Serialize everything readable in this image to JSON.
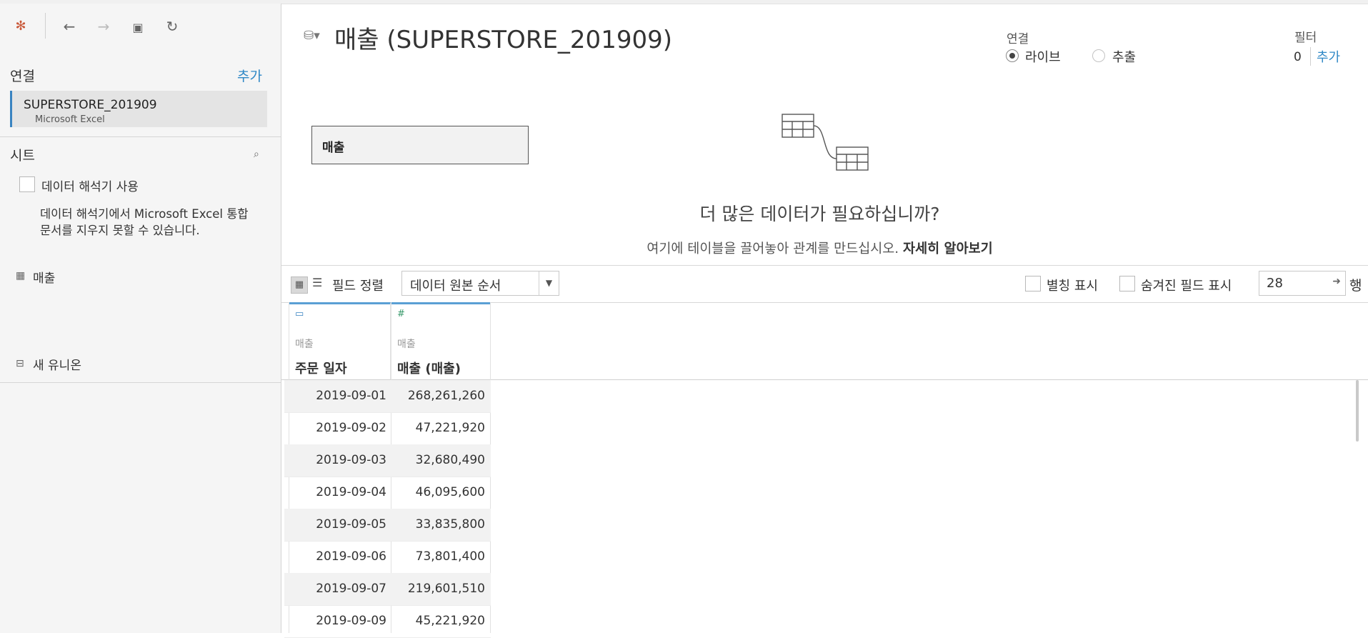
{
  "sidebar": {
    "connections_label": "연결",
    "add_label": "추가",
    "connection": {
      "name": "SUPERSTORE_201909",
      "type": "Microsoft Excel"
    },
    "sheets_label": "시트",
    "interpreter_label": "데이터 해석기 사용",
    "interpreter_desc": "데이터 해석기에서 Microsoft Excel 통합 문서를 지우지 못할 수 있습니다.",
    "sheet_item": "매출",
    "new_union": "새 유니온"
  },
  "header": {
    "title": "매출 (SUPERSTORE_201909)",
    "connection_label": "연결",
    "live_label": "라이브",
    "extract_label": "추출",
    "filter_label": "필터",
    "filter_count": "0",
    "filter_add": "추가"
  },
  "canvas": {
    "table_name": "매출",
    "prompt_title": "더 많은 데이터가 필요하십니까?",
    "prompt_text": "여기에 테이블을 끌어놓아 관계를 만드십시오.",
    "prompt_link": "자세히 알아보기"
  },
  "grid_toolbar": {
    "sort_label": "필드 정렬",
    "sort_value": "데이터 원본 순서",
    "alias_label": "별칭 표시",
    "hidden_label": "숨겨진 필드 표시",
    "rows_value": "28",
    "rows_label": "행"
  },
  "grid": {
    "columns": [
      {
        "source": "매출",
        "name": "주문 일자",
        "type_icon": "calendar-icon"
      },
      {
        "source": "매출",
        "name": "매출 (매출)",
        "type_icon": "number-hash-icon"
      }
    ],
    "rows": [
      [
        "2019-09-01",
        "268,261,260"
      ],
      [
        "2019-09-02",
        "47,221,920"
      ],
      [
        "2019-09-03",
        "32,680,490"
      ],
      [
        "2019-09-04",
        "46,095,600"
      ],
      [
        "2019-09-05",
        "33,835,800"
      ],
      [
        "2019-09-06",
        "73,801,400"
      ],
      [
        "2019-09-07",
        "219,601,510"
      ],
      [
        "2019-09-09",
        "45,221,920"
      ]
    ]
  },
  "colors": {
    "accent": "#2f88c6",
    "header_bar": "#5a9fd4"
  }
}
